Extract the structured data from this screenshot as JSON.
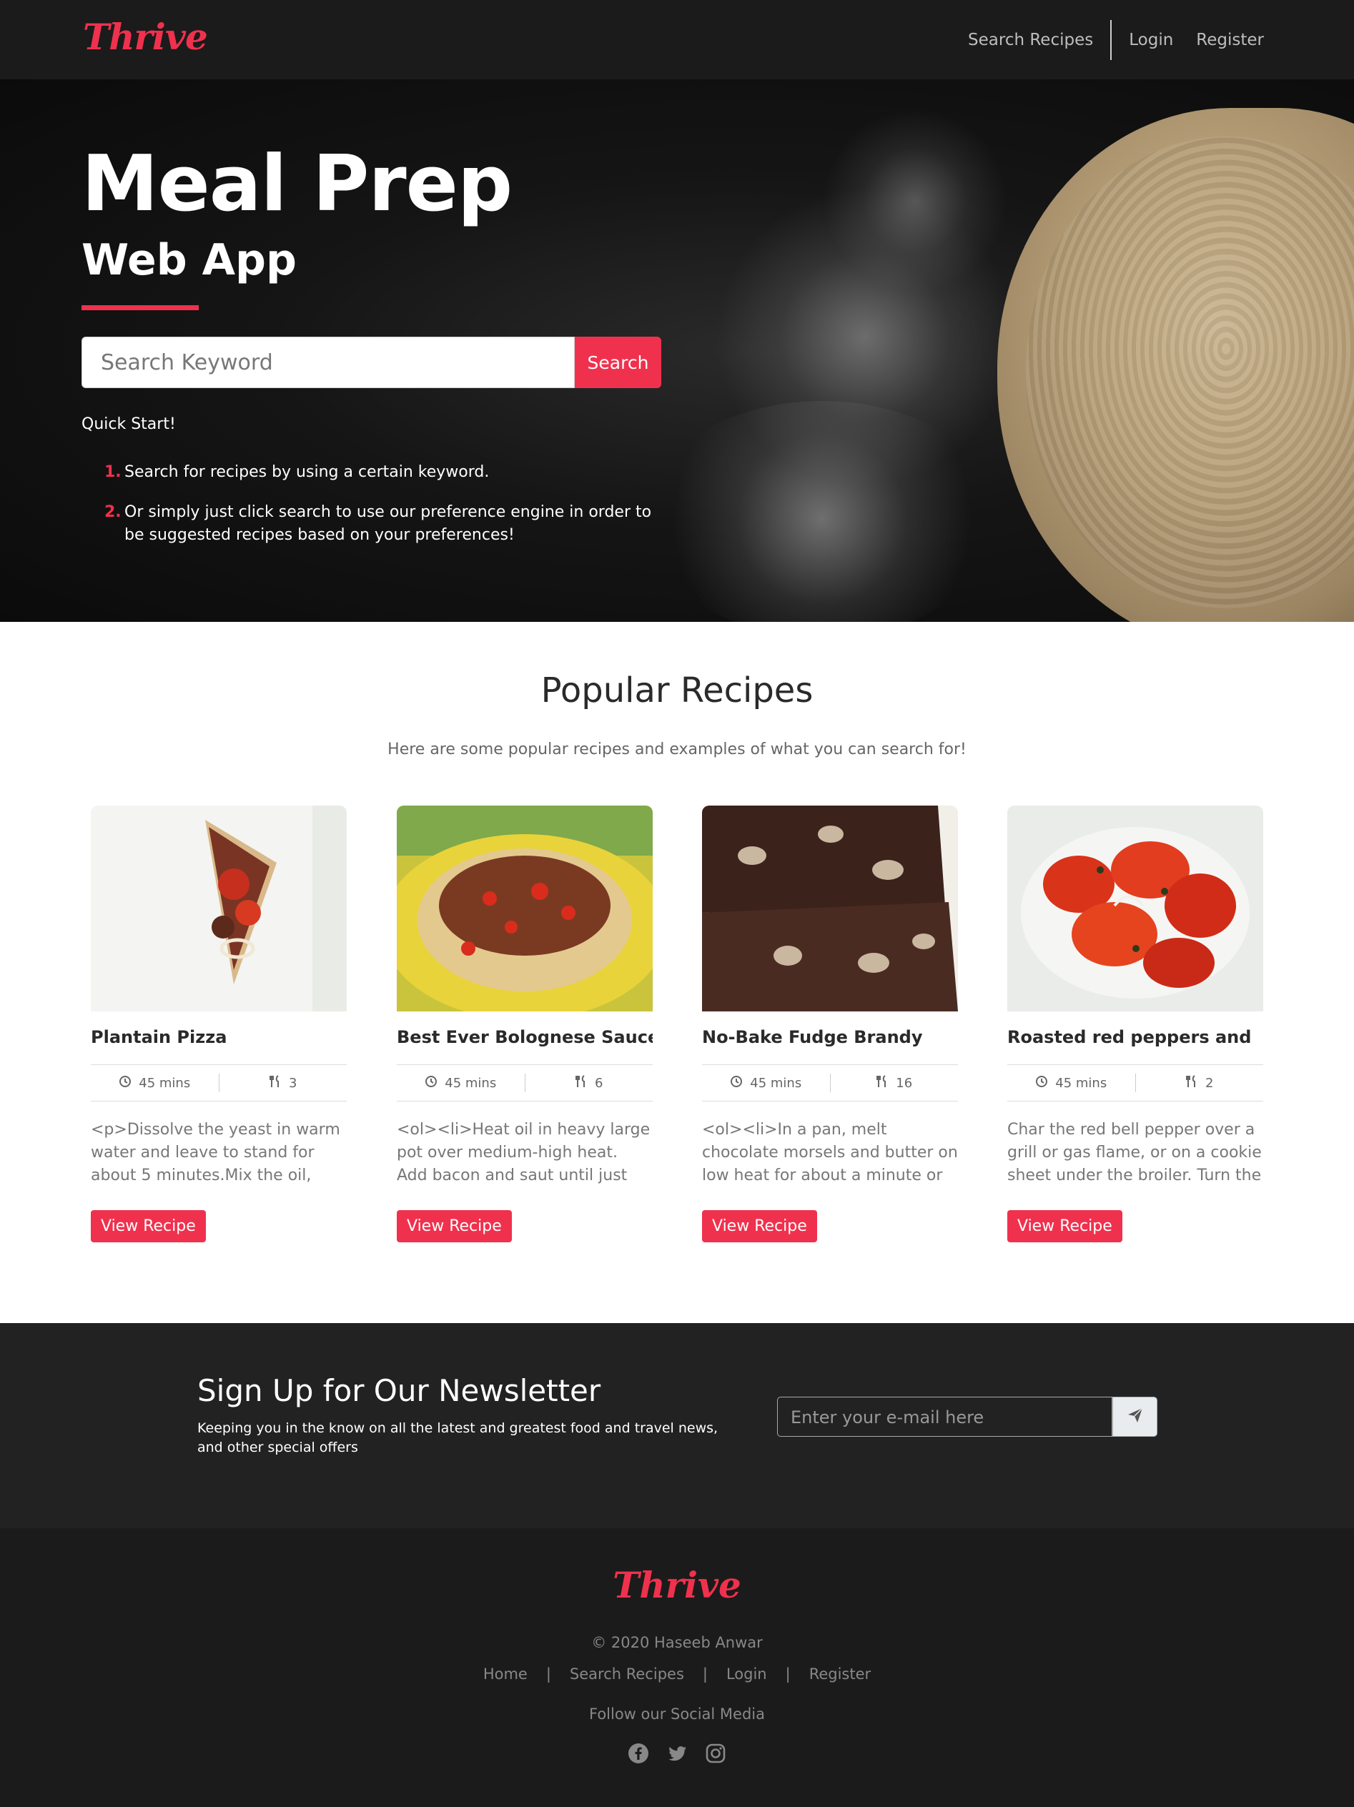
{
  "nav": {
    "brand": "Thrive",
    "links": [
      "Search Recipes",
      "Login",
      "Register"
    ]
  },
  "hero": {
    "title": "Meal Prep",
    "subtitle": "Web App",
    "search_placeholder": "Search Keyword",
    "search_button": "Search",
    "quick_start": "Quick Start!",
    "steps": [
      {
        "num": "1.",
        "text": "Search for recipes by using a certain keyword."
      },
      {
        "num": "2.",
        "text": "Or simply just click search to use our preference engine in order to be suggested recipes based on your preferences!"
      }
    ]
  },
  "popular": {
    "title": "Popular Recipes",
    "subtitle": "Here are some popular recipes and examples of what you can search for!",
    "cards": [
      {
        "title": "Plantain Pizza",
        "time": "45 mins",
        "servings": "3",
        "desc": "<p>Dissolve the yeast in warm water and leave to stand for about 5 minutes.Mix the oil, flour,",
        "button": "View Recipe"
      },
      {
        "title": "Best Ever Bolognese Sauce",
        "time": "45 mins",
        "servings": "6",
        "desc": "<ol><li>Heat oil in heavy large pot over medium-high heat. Add bacon and saut until just",
        "button": "View Recipe"
      },
      {
        "title": "No-Bake Fudge Brandy",
        "time": "45 mins",
        "servings": "16",
        "desc": "<ol><li>In a pan, melt chocolate morsels and butter on low heat for about a minute or until",
        "button": "View Recipe"
      },
      {
        "title": "Roasted red peppers and",
        "time": "45 mins",
        "servings": "2",
        "desc": "Char the red bell pepper over a grill or gas flame, or on a cookie sheet under the broiler. Turn the",
        "button": "View Recipe"
      }
    ]
  },
  "newsletter": {
    "title": "Sign Up for Our Newsletter",
    "text": "Keeping you in the know on all the latest and greatest food and travel news, and other special offers",
    "placeholder": "Enter your e-mail here"
  },
  "footer": {
    "brand": "Thrive",
    "copyright": "© 2020 Haseeb Anwar",
    "links": [
      "Home",
      "Search Recipes",
      "Login",
      "Register"
    ],
    "follow": "Follow our Social Media",
    "social_icons": [
      "facebook-icon",
      "twitter-icon",
      "instagram-icon"
    ]
  },
  "colors": {
    "accent": "#f0314d",
    "dark": "#1b1b1b",
    "newsletter_bg": "#222222"
  }
}
